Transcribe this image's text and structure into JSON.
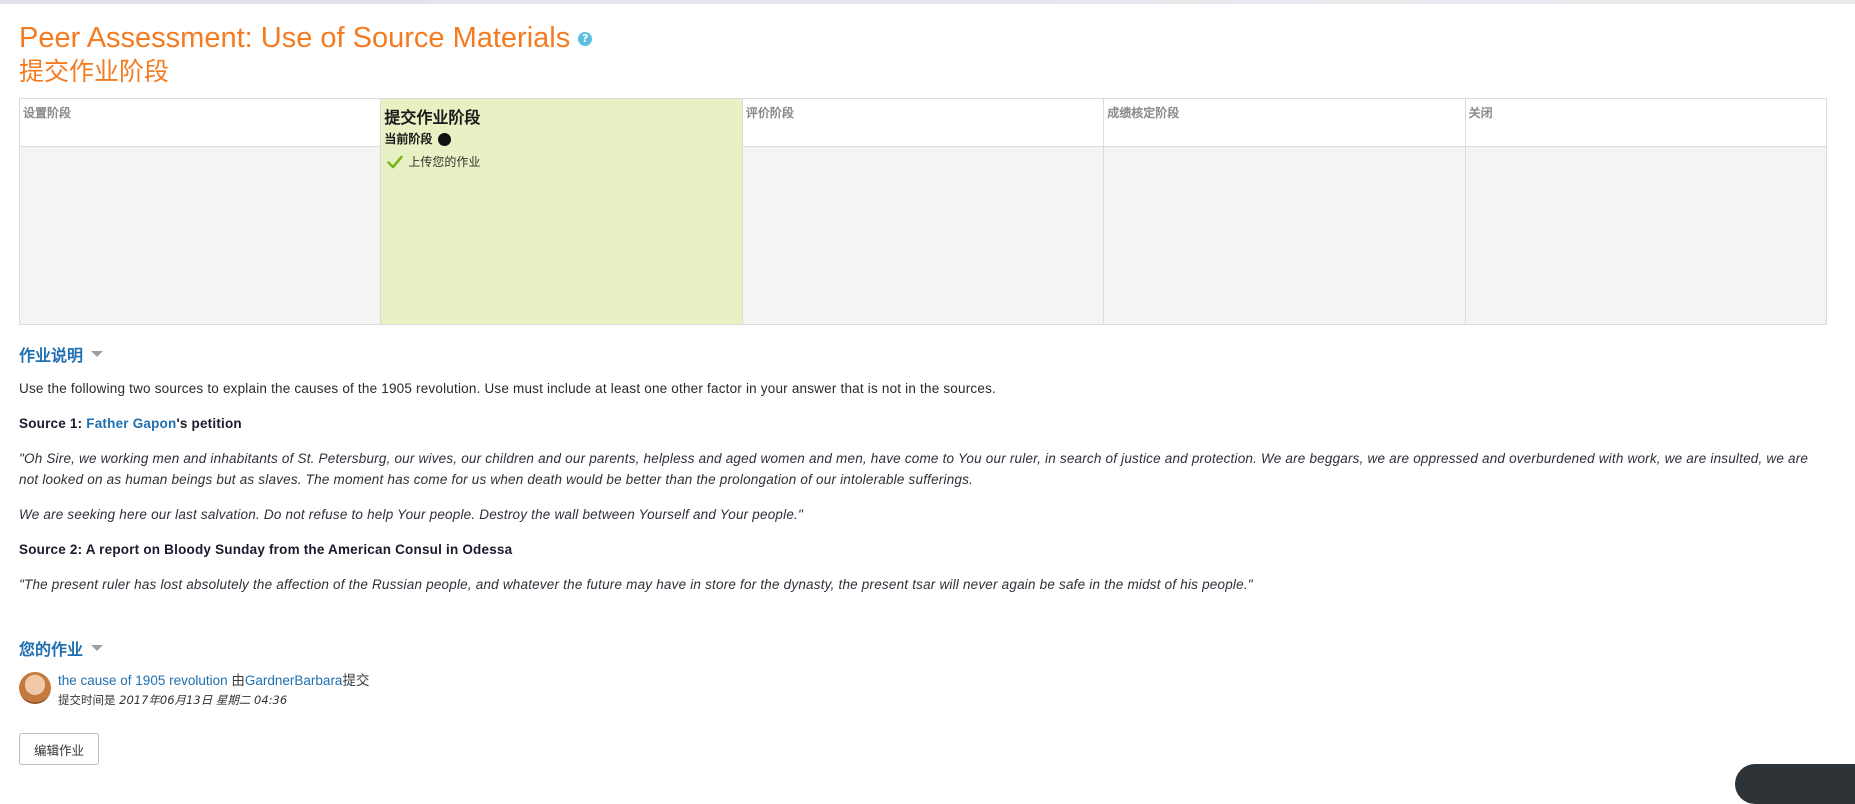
{
  "header": {
    "title": "Peer Assessment: Use of Source Materials",
    "help_glyph": "?",
    "current_phase_heading": "提交作业阶段"
  },
  "phases": [
    {
      "name": "设置阶段",
      "active": false
    },
    {
      "name": "提交作业阶段",
      "active": true,
      "current_label": "当前阶段",
      "tasks": [
        {
          "label": "上传您的作业",
          "done": true
        }
      ]
    },
    {
      "name": "评价阶段",
      "active": false
    },
    {
      "name": "成绩核定阶段",
      "active": false
    },
    {
      "name": "关闭",
      "active": false
    }
  ],
  "instructions": {
    "section_title": "作业说明",
    "intro": "Use the following two sources to explain the causes of the 1905 revolution. Use must include at least one other factor in your answer that is not in the sources.",
    "source1_prefix": "Source 1: ",
    "source1_link": "Father Gapon",
    "source1_suffix": "'s petition",
    "quote1a": "\"Oh Sire, we working men and inhabitants of St. Petersburg, our wives, our children and our parents, helpless and aged women and men, have come to You our ruler, in search of justice and protection. We are beggars, we are oppressed and overburdened with work, we are insulted, we are not looked on as human beings but as slaves. The moment has come for us when death would be better than the prolongation of our intolerable sufferings.",
    "quote1b": "We are seeking here our last salvation. Do not refuse to help Your people. Destroy the wall between Yourself and Your people.\"",
    "source2": "Source 2: A report on Bloody Sunday from the American Consul in Odessa",
    "quote2": "\"The present ruler has lost absolutely the affection of the Russian people, and whatever the future may have in store for the dynasty, the present tsar will never again be safe in the midst of his people.\""
  },
  "submission": {
    "section_title": "您的作业",
    "title_link": "the cause of 1905 revolution",
    "by_prefix": "由",
    "author": "GardnerBarbara",
    "by_suffix": "提交",
    "time_label": "提交时间是",
    "time_value": "2017年06月13日 星期二 04:36",
    "edit_button": "编辑作业"
  },
  "colors": {
    "title": "#f47b20",
    "link": "#1f6fb0",
    "active_phase_bg": "#e7f1c3",
    "help_icon": "#5bc0de"
  }
}
